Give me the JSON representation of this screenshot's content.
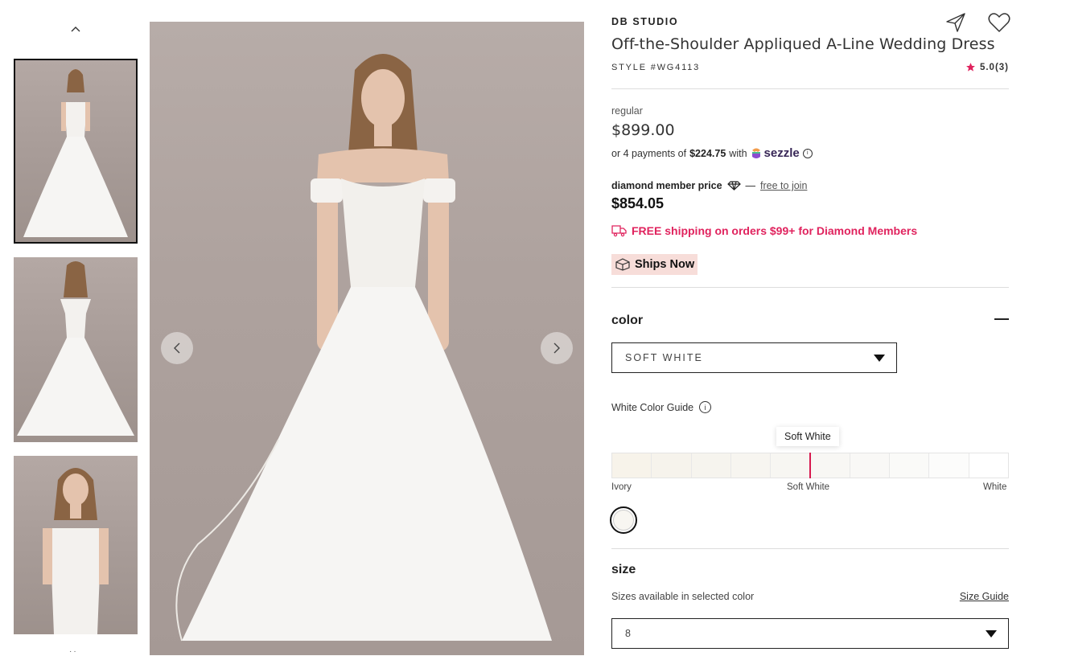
{
  "brand": "DB STUDIO",
  "product": {
    "title": "Off-the-Shoulder Appliqued A-Line Wedding Dress",
    "style": "STYLE #WG4113",
    "rating": "5.0(3)"
  },
  "pricing": {
    "regular_label": "regular",
    "regular_price": "$899.00",
    "installments_prefix": "or 4 payments of",
    "installment_amount": "$224.75",
    "installments_with": "with",
    "sezzle_label": "sezzle",
    "member_label": "diamond member price",
    "member_dash": "—",
    "member_link": "free to join",
    "member_price": "$854.05",
    "shipping": "FREE shipping on orders $99+ for Diamond Members",
    "ships_now": "Ships Now"
  },
  "color": {
    "section_title": "color",
    "selected": "SOFT WHITE",
    "guide_label": "White Color Guide",
    "tooltip": "Soft White",
    "scale_labels": [
      "Ivory",
      "Soft White",
      "White"
    ],
    "scale_colors": [
      "#f7f3ea",
      "#f6f3ec",
      "#f6f4ee",
      "#f7f5f0",
      "#f7f6f2",
      "#f8f7f4",
      "#f9f8f6",
      "#fafaf8",
      "#fcfcfb",
      "#ffffff"
    ]
  },
  "size": {
    "section_title": "size",
    "note": "Sizes available in selected color",
    "guide_link": "Size Guide",
    "selected": "8"
  },
  "accent_color": "#e0235e",
  "icons": [
    "chevron-up-icon",
    "chevron-left-icon",
    "chevron-right-icon",
    "share-icon",
    "heart-icon",
    "star-icon",
    "truck-icon",
    "box-icon",
    "diamond-icon",
    "info-icon",
    "dropdown-caret-icon"
  ]
}
